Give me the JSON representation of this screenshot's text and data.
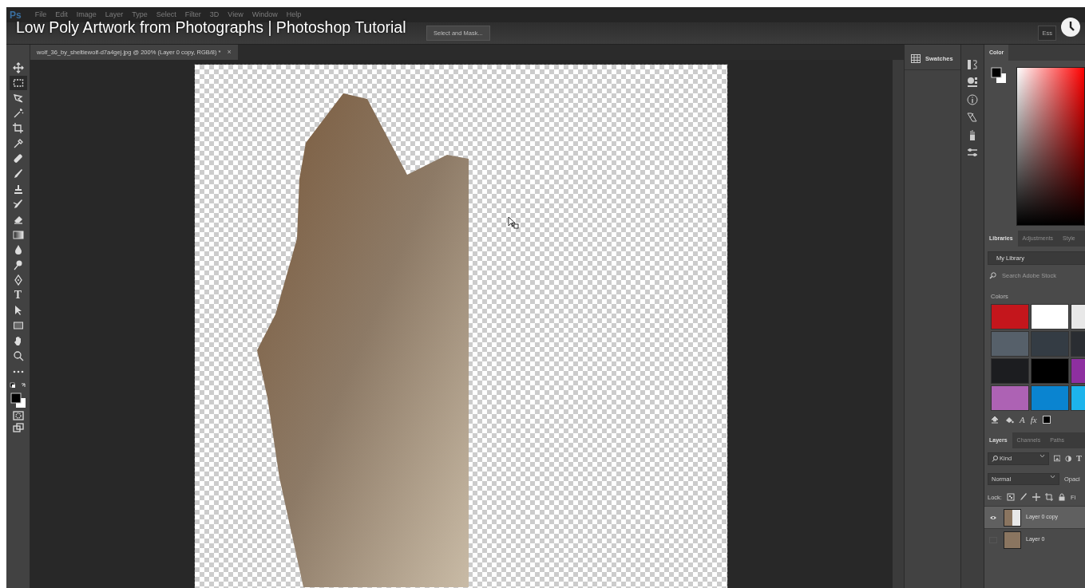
{
  "video_title": "Low Poly Artwork from Photographs | Photoshop Tutorial",
  "menu_bar": {
    "logo": "Ps",
    "items": [
      "File",
      "Edit",
      "Image",
      "Layer",
      "Type",
      "Select",
      "Filter",
      "3D",
      "View",
      "Window",
      "Help"
    ]
  },
  "options_bar": {
    "select_and_mask": "Select and Mask...",
    "workspace": "Ess"
  },
  "document_tab": {
    "title": "wolf_36_by_sheltiewolf-d7a4gej.jpg @ 200% (Layer 0 copy, RGB/8) *",
    "close": "×"
  },
  "tools": [
    {
      "kind": "move",
      "selected": false
    },
    {
      "kind": "marquee",
      "selected": true
    },
    {
      "kind": "lasso",
      "selected": false
    },
    {
      "kind": "wand",
      "selected": false
    },
    {
      "kind": "crop",
      "selected": false
    },
    {
      "kind": "eyedropper",
      "selected": false
    },
    {
      "kind": "bandage",
      "selected": false
    },
    {
      "kind": "brush",
      "selected": false
    },
    {
      "kind": "stamp",
      "selected": false
    },
    {
      "kind": "history",
      "selected": false
    },
    {
      "kind": "eraser",
      "selected": false
    },
    {
      "kind": "gradient",
      "selected": false
    },
    {
      "kind": "drop",
      "selected": false
    },
    {
      "kind": "dodge",
      "selected": false
    },
    {
      "kind": "pen",
      "selected": false
    },
    {
      "kind": "type",
      "selected": false,
      "glyph": "T"
    },
    {
      "kind": "arrow",
      "selected": false
    },
    {
      "kind": "rectangle",
      "selected": false
    },
    {
      "kind": "hand",
      "selected": false
    },
    {
      "kind": "zoom",
      "selected": false
    },
    {
      "kind": "more",
      "selected": false
    }
  ],
  "swatches_panel": {
    "label": "Swatches"
  },
  "color_panel": {
    "tab": "Color"
  },
  "library_tabs": [
    {
      "label": "Libraries",
      "selected": true
    },
    {
      "label": "Adjustments",
      "selected": false
    },
    {
      "label": "Style",
      "selected": false
    }
  ],
  "library": {
    "name": "My Library",
    "search_placeholder": "Search Adobe Stock",
    "colors_label": "Colors",
    "colors": [
      {
        "color": "#c4161c"
      },
      {
        "color": "#ffffff"
      },
      {
        "color": "#e8e8e8"
      },
      {
        "color": "#56606a"
      },
      {
        "color": "#343c44"
      },
      {
        "color": "#2a2d32"
      },
      {
        "color": "#1c1d20"
      },
      {
        "color": "#000000"
      },
      {
        "color": "#8e2fa0"
      },
      {
        "color": "#ad62b4"
      },
      {
        "color": "#0a84d0"
      },
      {
        "color": "#1db4ec"
      }
    ],
    "actions": [
      {
        "kind": "upload"
      },
      {
        "kind": "fill"
      },
      {
        "kind": "text",
        "label": "A"
      },
      {
        "kind": "text",
        "label": "fx"
      },
      {
        "kind": "swatch"
      }
    ]
  },
  "layer_tabs": [
    {
      "label": "Layers",
      "selected": true
    },
    {
      "label": "Channels",
      "selected": false
    },
    {
      "label": "Paths",
      "selected": false
    }
  ],
  "layers_panel": {
    "filter": "Kind",
    "filter_type_glyph": "T",
    "blend_mode": "Normal",
    "opacity_label": "Opaci",
    "lock_label": "Lock:",
    "fill_label": "Fi",
    "layers": [
      {
        "name": "Layer 0 copy",
        "visible": true,
        "selected": true,
        "transparent": true
      },
      {
        "name": "Layer 0",
        "visible": false,
        "selected": false,
        "transparent": false
      }
    ]
  }
}
